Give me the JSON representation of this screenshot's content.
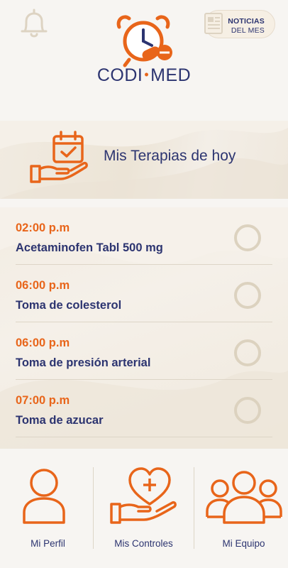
{
  "header": {
    "brand_left": "CODI",
    "brand_dot": "•",
    "brand_right": "MED",
    "news_line1": "NOTICIAS",
    "news_line2": "DEL MES"
  },
  "banner": {
    "title": "Mis Terapias de hoy"
  },
  "therapies": [
    {
      "time": "02:00 p.m",
      "name": "Acetaminofen Tabl 500 mg"
    },
    {
      "time": "06:00 p.m",
      "name": "Toma de colesterol"
    },
    {
      "time": "06:00 p.m",
      "name": "Toma de presión arterial"
    },
    {
      "time": "07:00 p.m",
      "name": "Toma de azucar"
    }
  ],
  "nav": {
    "profile": "Mi Perfil",
    "controls": "Mis Controles",
    "team": "Mi Equipo"
  },
  "colors": {
    "accent": "#e8651a",
    "navy": "#2c3470",
    "background": "#f7f5f2",
    "check_ring": "#dcd2bf"
  },
  "icons": [
    "bell-icon",
    "newspaper-icon",
    "alarm-clock-pill-logo",
    "calendar-hand-icon",
    "person-icon",
    "heart-hand-icon",
    "group-icon"
  ]
}
